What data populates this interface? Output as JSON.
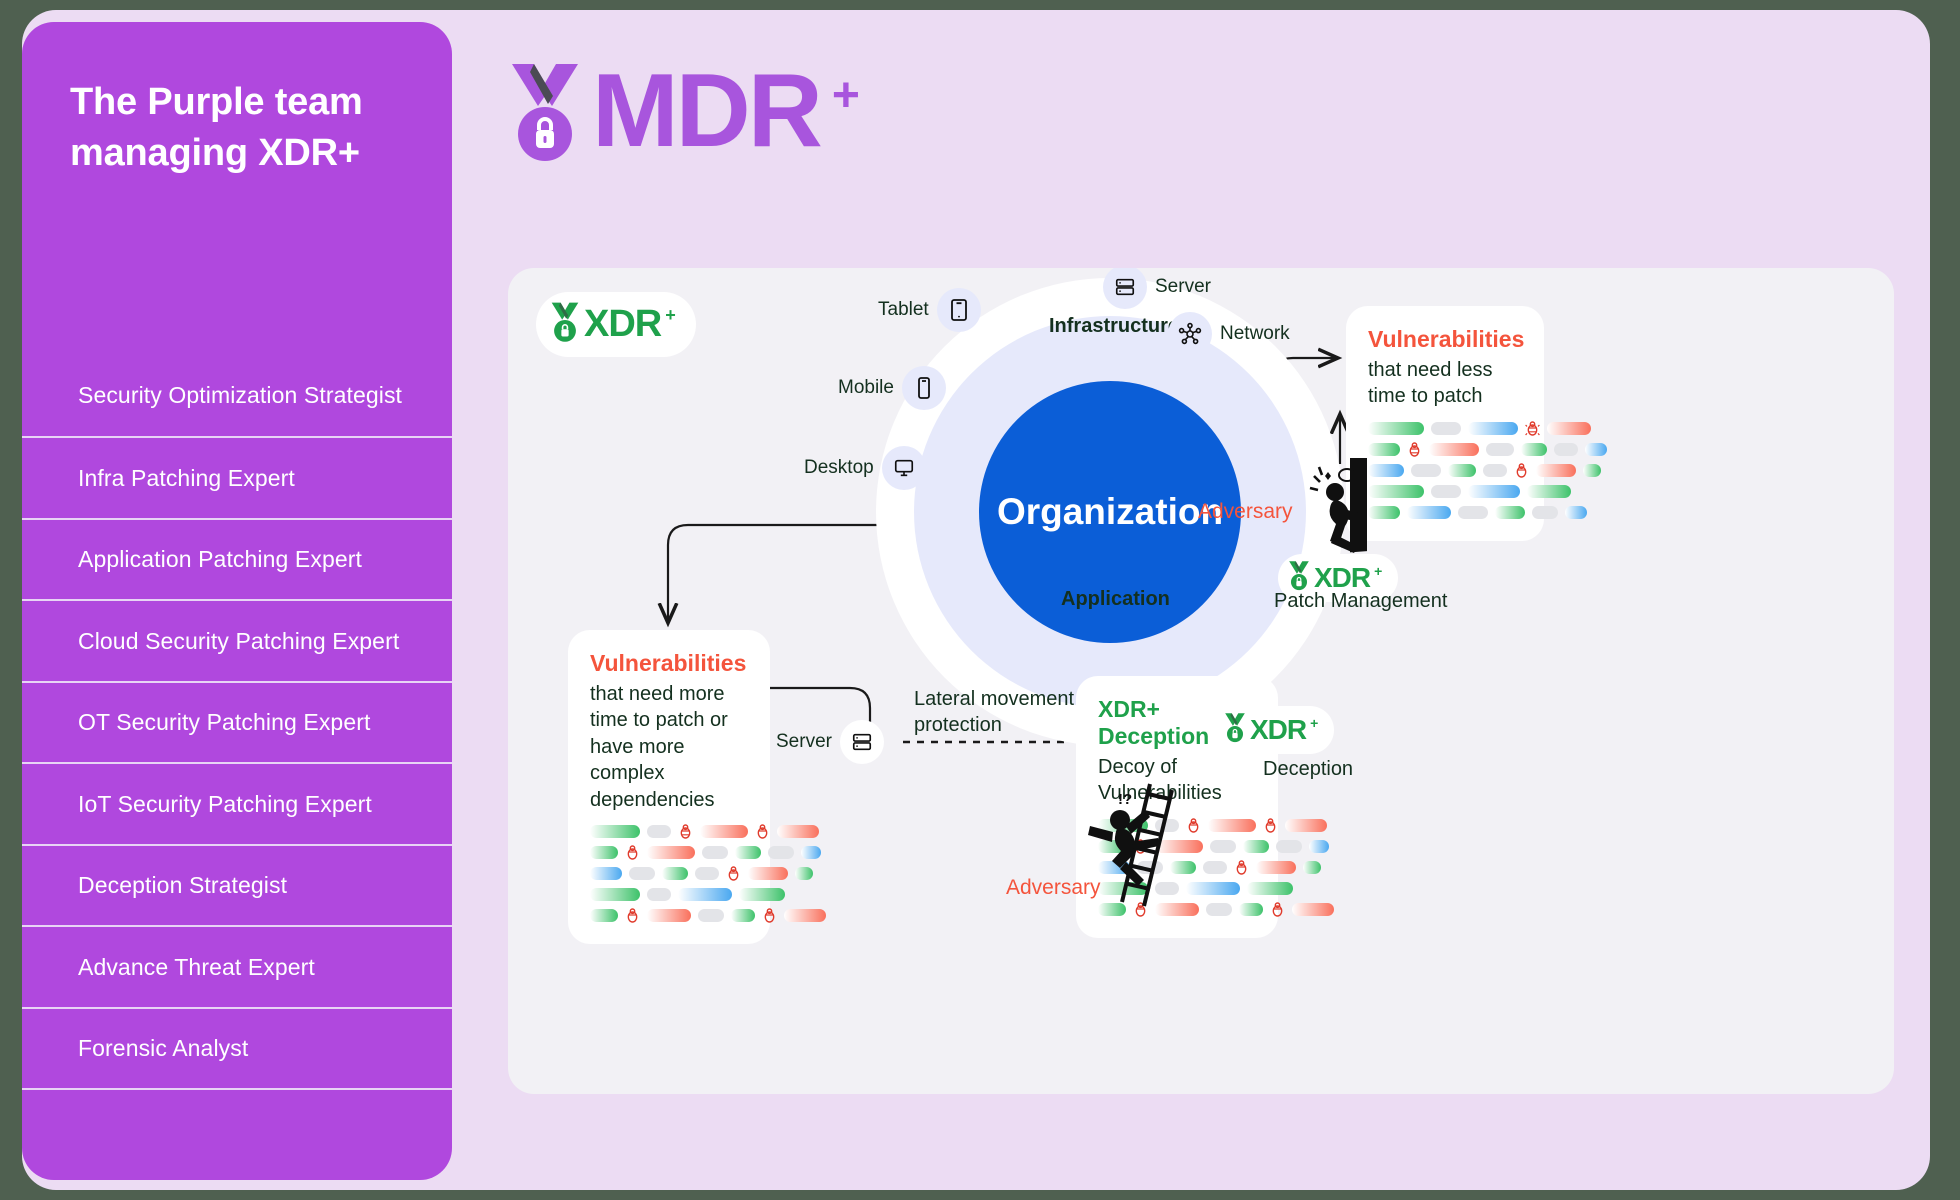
{
  "colors": {
    "outer_background": "#4f6050",
    "panel_background": "#ecdcf3",
    "sidebar_purple": "#b048de",
    "content_background": "#f2f1f5",
    "brand_purple": "#a855dd",
    "brand_green": "#1fa14b",
    "core_blue": "#0b5ed7",
    "mid_ring": "#e6e9fb",
    "vuln_red": "#f4543c",
    "text_dark": "#14301f"
  },
  "sidebar": {
    "title": "The Purple team managing XDR+",
    "items": [
      {
        "label": "Security Optimization Strategist"
      },
      {
        "label": "Infra Patching Expert"
      },
      {
        "label": "Application Patching Expert"
      },
      {
        "label": "Cloud Security Patching Expert"
      },
      {
        "label": "OT Security Patching Expert"
      },
      {
        "label": "IoT Security Patching Expert"
      },
      {
        "label": "Deception Strategist"
      },
      {
        "label": "Advance Threat Expert"
      },
      {
        "label": "Forensic Analyst"
      }
    ]
  },
  "header": {
    "logo_word": "MDR",
    "logo_plus": "+",
    "logo_icon": "medal-lock-icon"
  },
  "content": {
    "badge_top_left": {
      "word": "XDR",
      "plus": "+",
      "icon": "medal-lock-icon"
    },
    "rings": {
      "core_label": "Organization",
      "mid_label": "Infrastructure",
      "outer_label": "Application"
    },
    "nodes": [
      {
        "label": "Server",
        "icon": "server-icon"
      },
      {
        "label": "Network",
        "icon": "network-icon"
      },
      {
        "label": "Tablet",
        "icon": "tablet-icon"
      },
      {
        "label": "Mobile",
        "icon": "mobile-icon"
      },
      {
        "label": "Desktop",
        "icon": "desktop-icon"
      }
    ],
    "card_less_time": {
      "title": "Vulnerabilities",
      "subtitle": "that need less time to patch"
    },
    "card_more_time": {
      "title": "Vulnerabilities",
      "subtitle": "that need more time to patch or have more complex dependencies"
    },
    "card_deception": {
      "title": "XDR+ Deception",
      "subtitle": "Decoy of Vulnerabilities"
    },
    "adversary_top": {
      "label": "Adversary",
      "icon": "adversary-wall-icon"
    },
    "adversary_bottom": {
      "label": "Adversary",
      "icon": "adversary-ladder-icon"
    },
    "patch_management": {
      "badge": {
        "word": "XDR",
        "plus": "+",
        "icon": "medal-lock-icon"
      },
      "caption": "Patch Management"
    },
    "deception_badge": {
      "badge": {
        "word": "XDR",
        "plus": "+",
        "icon": "medal-lock-icon"
      },
      "caption": "Deception"
    },
    "server_node": {
      "label": "Server",
      "icon": "server-icon"
    },
    "lateral_movement": "Lateral movement\nprotection"
  }
}
